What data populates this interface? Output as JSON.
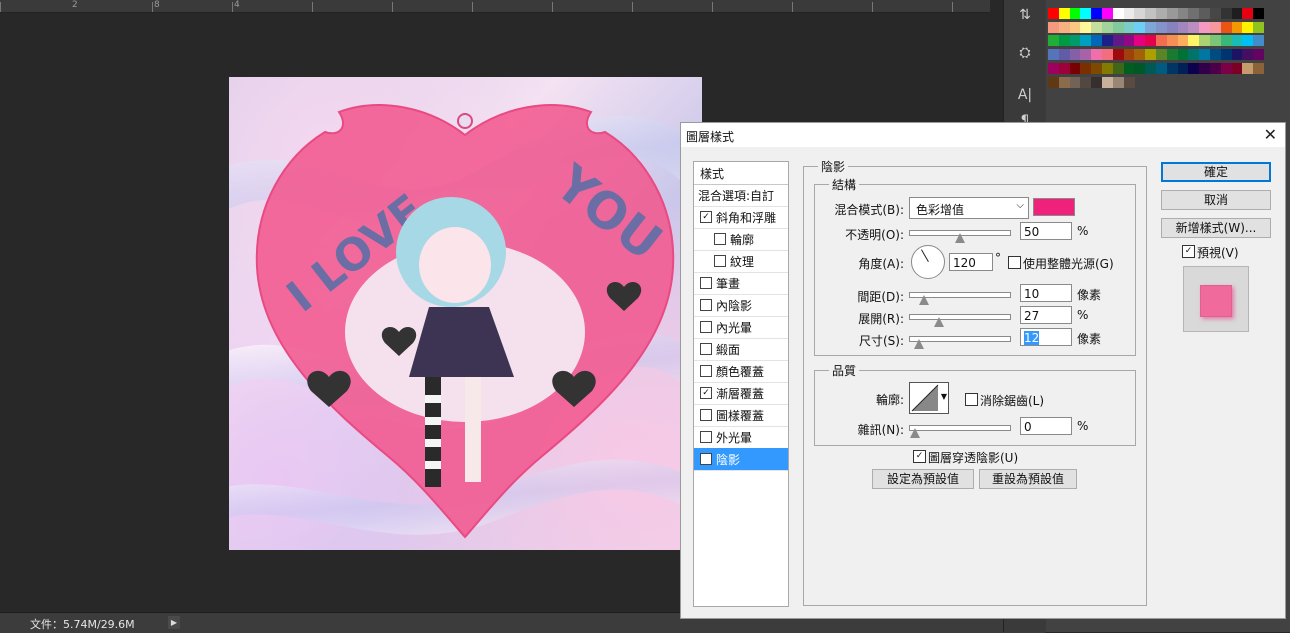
{
  "ruler": {
    "ticks": [
      "2",
      "8",
      "4"
    ]
  },
  "status": {
    "doc_info": "文件：5.74M/29.6M",
    "menu_arrow": "▶"
  },
  "artwork": {
    "text_left": "I LOVE",
    "text_right": "YOU",
    "colors": {
      "heart": "#f2558c",
      "outline": "#e94a82",
      "lettering": "#6a6ea4"
    }
  },
  "tools": {
    "icons": [
      "stamp-icon",
      "cube-icon",
      "character-icon",
      "paragraph-icon"
    ],
    "glyphs": [
      "⇅",
      "⛭",
      "A|",
      "¶"
    ]
  },
  "swatches": {
    "colors": [
      "#ff0000",
      "#ffff00",
      "#00ff00",
      "#00ffff",
      "#0000ff",
      "#ff00ff",
      "#ffffff",
      "#ebebeb",
      "#d6d6d6",
      "#c2c2c2",
      "#adadad",
      "#999999",
      "#858585",
      "#707070",
      "#5c5c5c",
      "#474747",
      "#333333",
      "#1e1e1e",
      "#e60012",
      "#000000",
      "#f39a7f",
      "#f7b07f",
      "#fbc884",
      "#fff799",
      "#c4df9b",
      "#a2d39c",
      "#82ca9d",
      "#7bcdc8",
      "#6ecff6",
      "#7ea7d8",
      "#8493ca",
      "#8882be",
      "#a187be",
      "#bc8dbf",
      "#f49ac2",
      "#f6989d",
      "#ea5514",
      "#f39800",
      "#fff100",
      "#8fc31f",
      "#22ac38",
      "#009944",
      "#009b6b",
      "#00a0c1",
      "#0068b7",
      "#1d2088",
      "#601986",
      "#920783",
      "#e4007f",
      "#e5004f",
      "#f26c4f",
      "#f68e55",
      "#fbaf5c",
      "#fff467",
      "#acd372",
      "#7cc576",
      "#3bb878",
      "#1abbb4",
      "#00bff3",
      "#438cca",
      "#5574b9",
      "#605ca8",
      "#855fa8",
      "#a763a8",
      "#f06ea9",
      "#f26d7d",
      "#9e0b0f",
      "#a0410d",
      "#a36209",
      "#aba000",
      "#598527",
      "#1a7b30",
      "#007236",
      "#00746b",
      "#0076a3",
      "#004b80",
      "#003471",
      "#1b1464",
      "#440e62",
      "#630460",
      "#9e005d",
      "#9e0039",
      "#790000",
      "#7b2e00",
      "#7d4900",
      "#827b00",
      "#406618",
      "#005e20",
      "#005826",
      "#005952",
      "#005b7f",
      "#003663",
      "#002157",
      "#0d004c",
      "#32004b",
      "#4b0049",
      "#7b0046",
      "#7a0026",
      "#c69c6d",
      "#8c6239",
      "#603813",
      "#8a6b4b",
      "#736357",
      "#534741",
      "#362f2d",
      "#c7b299",
      "#998675",
      "#594a42"
    ]
  },
  "dialog": {
    "title": "圖層樣式",
    "close_glyph": "✕",
    "styles_header": "樣式",
    "style_items": [
      {
        "label": "混合選項:自訂",
        "checkbox": false,
        "checked": false,
        "indent": 0
      },
      {
        "label": "斜角和浮雕",
        "checkbox": true,
        "checked": true,
        "indent": 0
      },
      {
        "label": "輪廓",
        "checkbox": true,
        "checked": false,
        "indent": 1
      },
      {
        "label": "紋理",
        "checkbox": true,
        "checked": false,
        "indent": 1
      },
      {
        "label": "筆畫",
        "checkbox": true,
        "checked": false,
        "indent": 0
      },
      {
        "label": "內陰影",
        "checkbox": true,
        "checked": false,
        "indent": 0
      },
      {
        "label": "內光暈",
        "checkbox": true,
        "checked": false,
        "indent": 0
      },
      {
        "label": "緞面",
        "checkbox": true,
        "checked": false,
        "indent": 0
      },
      {
        "label": "顏色覆蓋",
        "checkbox": true,
        "checked": false,
        "indent": 0
      },
      {
        "label": "漸層覆蓋",
        "checkbox": true,
        "checked": true,
        "indent": 0
      },
      {
        "label": "圖樣覆蓋",
        "checkbox": true,
        "checked": false,
        "indent": 0
      },
      {
        "label": "外光暈",
        "checkbox": true,
        "checked": false,
        "indent": 0
      },
      {
        "label": "陰影",
        "checkbox": true,
        "checked": true,
        "indent": 0,
        "selected": true
      }
    ],
    "shadow": {
      "group_title": "陰影",
      "structure_title": "結構",
      "blend_mode_label": "混合模式(B):",
      "blend_mode_value": "色彩增值",
      "shadow_color": "#f0217a",
      "opacity_label": "不透明(O):",
      "opacity_value": "50",
      "opacity_unit": "%",
      "opacity": 50,
      "angle_label": "角度(A):",
      "angle_value": "120",
      "angle_unit": "°",
      "angle_deg": 120,
      "global_light_label": "使用整體光源(G)",
      "distance_label": "間距(D):",
      "distance_value": "10",
      "distance_unit": "像素",
      "distance": 10,
      "spread_label": "展開(R):",
      "spread_value": "27",
      "spread_unit": "%",
      "spread": 27,
      "size_label": "尺寸(S):",
      "size_value": "12",
      "size_unit": "像素",
      "size": 12,
      "quality_title": "品質",
      "contour_label": "輪廓:",
      "antialias_label": "消除鋸齒(L)",
      "noise_label": "雜訊(N):",
      "noise_value": "0",
      "noise_unit": "%",
      "noise": 0,
      "knockout_label": "圖層穿透陰影(U)",
      "make_default": "設定為預設值",
      "reset_default": "重設為預設值"
    },
    "buttons": {
      "ok": "確定",
      "cancel": "取消",
      "new_style": "新增樣式(W)...",
      "preview_label": "預視(V)"
    },
    "preview_color": "#f06a9c"
  }
}
